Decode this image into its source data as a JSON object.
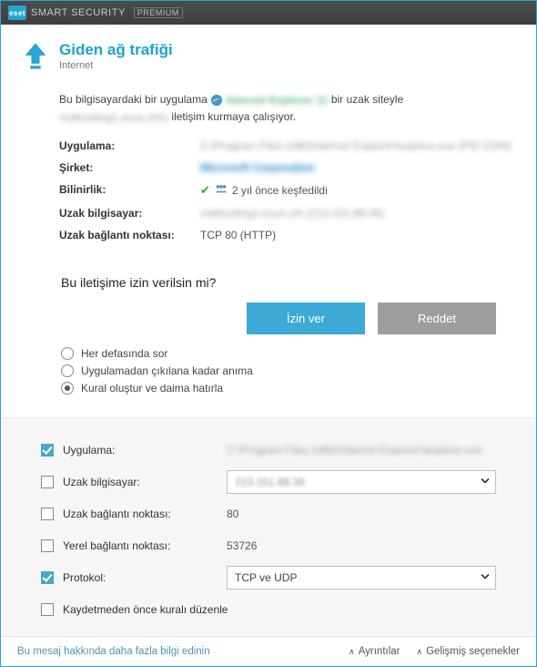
{
  "titlebar": {
    "brand_badge": "eset",
    "brand_text": "SMART SECURITY",
    "brand_tag": "PREMIUM"
  },
  "header": {
    "title": "Giden ağ trafiği",
    "subtitle": "Internet"
  },
  "intro": {
    "prefix": "Bu bilgisayardaki bir uygulama ",
    "app_blur": "Internet Explorer 11",
    "mid": " bir uzak siteyle ",
    "site_blur": "malhosting1.ecus.orhs",
    "suffix": " iletişim kurmaya çalışıyor."
  },
  "attrs": {
    "app_label": "Uygulama:",
    "app_value_blur": "C:\\Program Files (x86)\\Internet Explorer\\iexplore.exe (PID 2344)",
    "company_label": "Şirket:",
    "company_value_blur": "Microsoft Corporation",
    "reputation_label": "Bilinirlik:",
    "reputation_value": "2 yıl önce keşfedildi",
    "remote_label": "Uzak bilgisayar:",
    "remote_value_blur": "malhosting1.ecus.orh (213.151.88.36)",
    "remoteport_label": "Uzak bağlantı noktası:",
    "remoteport_value": "TCP 80 (HTTP)"
  },
  "question": {
    "text": "Bu iletişime izin verilsin mi?",
    "allow": "İzin ver",
    "deny": "Reddet"
  },
  "radios": {
    "ask": "Her defasında sor",
    "until_quit": "Uygulamadan çıkılana kadar anıma",
    "remember": "Kural oluştur ve daima hatırla"
  },
  "rules": {
    "app_label": "Uygulama:",
    "app_value_blur": "C:\\Program Files (x86)\\Internet Explorer\\iexplore.exe",
    "remote_label": "Uzak bilgisayar:",
    "remote_value_blur": "213.151.88.36",
    "remoteport_label": "Uzak bağlantı noktası:",
    "remoteport_value": "80",
    "localport_label": "Yerel bağlantı noktası:",
    "localport_value": "53726",
    "protocol_label": "Protokol:",
    "protocol_value": "TCP ve UDP",
    "edit_label": "Kaydetmeden önce kuralı düzenle"
  },
  "footer": {
    "more_info": "Bu mesaj hakkında daha fazla bilgi edinin",
    "details": "Ayrıntılar",
    "advanced": "Gelişmiş seçenekler"
  }
}
